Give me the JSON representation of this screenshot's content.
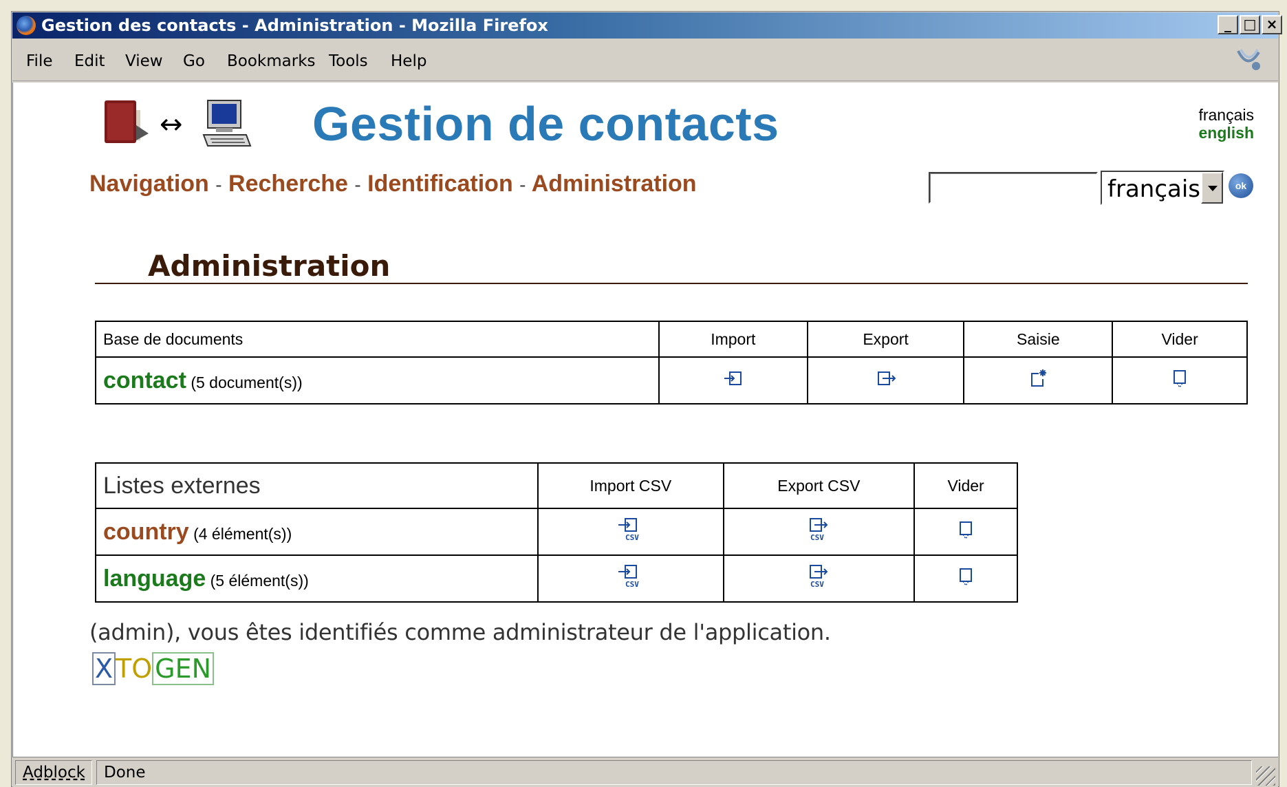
{
  "window": {
    "title": "Gestion des contacts - Administration - Mozilla Firefox",
    "controls": {
      "minimize": "_",
      "maximize": "□",
      "close": "×"
    }
  },
  "menubar": {
    "items": [
      {
        "label": "File"
      },
      {
        "label": "Edit"
      },
      {
        "label": "View"
      },
      {
        "label": "Go"
      },
      {
        "label": "Bookmarks"
      },
      {
        "label": "Tools"
      },
      {
        "label": "Help"
      }
    ]
  },
  "header": {
    "logo_arrow": "↔",
    "title": "Gestion de contacts",
    "languages": {
      "french": "français",
      "english": "english"
    }
  },
  "nav": {
    "items": [
      "Navigation",
      "Recherche",
      "Identification",
      "Administration"
    ],
    "separator": "-"
  },
  "search": {
    "value": "",
    "language_select": "français",
    "ok_label": "ok"
  },
  "admin": {
    "title": "Administration",
    "documents_table": {
      "headers": [
        "Base de documents",
        "Import",
        "Export",
        "Saisie",
        "Vider"
      ],
      "rows": [
        {
          "name": "contact",
          "count": "(5 document(s))",
          "icons": [
            "import-icon",
            "export-icon",
            "new-entry-icon",
            "empty-icon"
          ]
        }
      ]
    },
    "lists_table": {
      "headers": [
        "Listes externes",
        "Import CSV",
        "Export CSV",
        "Vider"
      ],
      "rows": [
        {
          "name": "country",
          "count": "(4 élément(s))",
          "icons": [
            "import-csv-icon",
            "export-csv-icon",
            "empty-icon"
          ]
        },
        {
          "name": "language",
          "count": "(5 élément(s))",
          "icons": [
            "import-csv-icon",
            "export-csv-icon",
            "empty-icon"
          ]
        }
      ]
    },
    "message": "(admin), vous êtes identifiés comme administrateur de l'application.",
    "credit": {
      "x": "X",
      "to": "TO",
      "gen": "GEN"
    }
  },
  "statusbar": {
    "adblock": "Adblock",
    "status": "Done"
  },
  "colors": {
    "title_blue": "#2a7ab8",
    "nav_brown": "#9a4a1e",
    "green": "#1b7a1b",
    "heading_brown": "#3a1a08"
  }
}
